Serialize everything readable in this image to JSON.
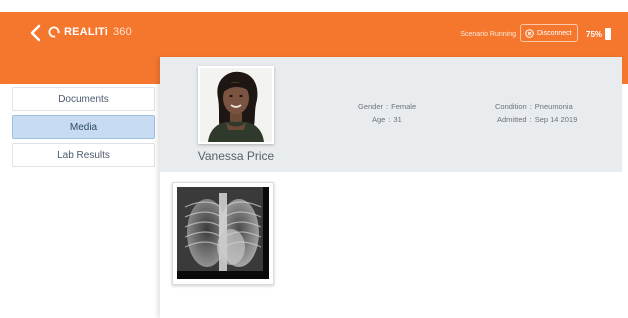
{
  "header": {
    "logo_text": "REALITi",
    "logo_suffix": "360",
    "status_text": "Scenario Running",
    "disconnect_label": "Disconnect",
    "battery_percent": "75%"
  },
  "sidebar": {
    "items": [
      {
        "label": "Documents",
        "active": false
      },
      {
        "label": "Media",
        "active": true
      },
      {
        "label": "Lab Results",
        "active": false
      }
    ]
  },
  "patient": {
    "name": "Vanessa Price",
    "gender_label": "Gender",
    "gender_value": "Female",
    "age_label": "Age",
    "age_value": "31",
    "condition_label": "Condition",
    "condition_value": "Pneumonia",
    "admitted_label": "Admitted",
    "admitted_value": "Sep 14 2019"
  },
  "colors": {
    "header": "#f5772e",
    "active_tab": "#c7dcf2",
    "patient_bar": "#e9ecee"
  }
}
